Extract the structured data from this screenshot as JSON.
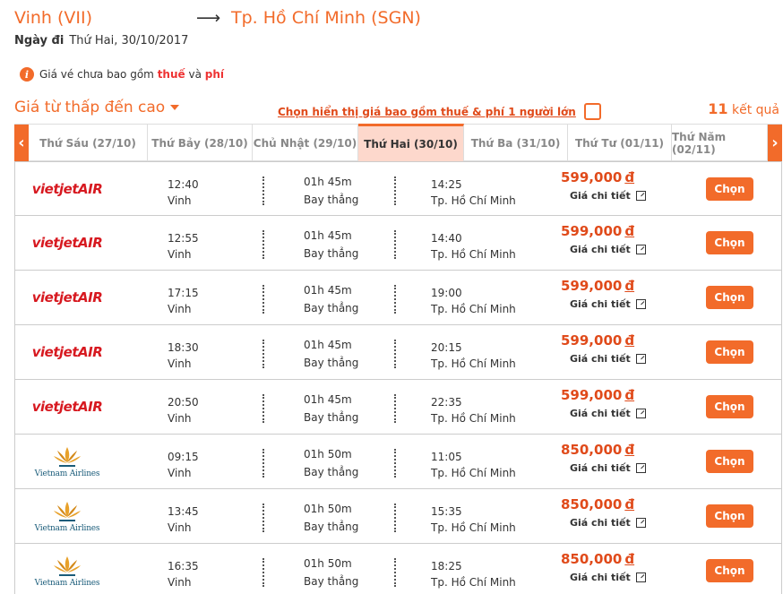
{
  "route": {
    "from": "Vinh (VII)",
    "arrow": "⟶",
    "to": "Tp. Hồ Chí Minh (SGN)"
  },
  "date": {
    "label": "Ngày đi",
    "value": "Thứ Hai, 30/10/2017"
  },
  "notice": {
    "prefix": "Giá vé chưa bao gồm",
    "tax": "thuế",
    "and": "và",
    "fee": "phí"
  },
  "sort": {
    "label": "Giá từ thấp đến cao"
  },
  "include_toggle": {
    "label": "Chọn hiển thị giá bao gồm thuế & phí 1 người lớn"
  },
  "results": {
    "count": "11",
    "label": "kết quả"
  },
  "date_tabs": [
    {
      "label": "Thứ Sáu (27/10)"
    },
    {
      "label": "Thứ Bảy (28/10)"
    },
    {
      "label": "Chủ Nhật (29/10)"
    },
    {
      "label": "Thứ Hai (30/10)",
      "active": true
    },
    {
      "label": "Thứ Ba (31/10)"
    },
    {
      "label": "Thứ Tư (01/11)"
    },
    {
      "label": "Thứ Năm (02/11)"
    }
  ],
  "nav": {
    "prev_icon": "chevron-left-icon",
    "next_icon": "chevron-right-icon"
  },
  "labels": {
    "detail": "Giá chi tiết",
    "choose": "Chọn",
    "currency": "đ"
  },
  "airlines": {
    "vietjet": {
      "brand_color": "#d71920",
      "logo_text": "VietJet Air"
    },
    "vietnam": {
      "brand_color": "#1a5c7a",
      "logo_text": "Vietnam Airlines"
    }
  },
  "flights": [
    {
      "airline": "vietjet",
      "dep_time": "12:40",
      "dep_city": "Vinh",
      "duration": "01h 45m",
      "type": "Bay thẳng",
      "arr_time": "14:25",
      "arr_city": "Tp. Hồ Chí Minh",
      "price": "599,000"
    },
    {
      "airline": "vietjet",
      "dep_time": "12:55",
      "dep_city": "Vinh",
      "duration": "01h 45m",
      "type": "Bay thẳng",
      "arr_time": "14:40",
      "arr_city": "Tp. Hồ Chí Minh",
      "price": "599,000"
    },
    {
      "airline": "vietjet",
      "dep_time": "17:15",
      "dep_city": "Vinh",
      "duration": "01h 45m",
      "type": "Bay thẳng",
      "arr_time": "19:00",
      "arr_city": "Tp. Hồ Chí Minh",
      "price": "599,000"
    },
    {
      "airline": "vietjet",
      "dep_time": "18:30",
      "dep_city": "Vinh",
      "duration": "01h 45m",
      "type": "Bay thẳng",
      "arr_time": "20:15",
      "arr_city": "Tp. Hồ Chí Minh",
      "price": "599,000"
    },
    {
      "airline": "vietjet",
      "dep_time": "20:50",
      "dep_city": "Vinh",
      "duration": "01h 45m",
      "type": "Bay thẳng",
      "arr_time": "22:35",
      "arr_city": "Tp. Hồ Chí Minh",
      "price": "599,000"
    },
    {
      "airline": "vietnam",
      "dep_time": "09:15",
      "dep_city": "Vinh",
      "duration": "01h 50m",
      "type": "Bay thẳng",
      "arr_time": "11:05",
      "arr_city": "Tp. Hồ Chí Minh",
      "price": "850,000"
    },
    {
      "airline": "vietnam",
      "dep_time": "13:45",
      "dep_city": "Vinh",
      "duration": "01h 50m",
      "type": "Bay thẳng",
      "arr_time": "15:35",
      "arr_city": "Tp. Hồ Chí Minh",
      "price": "850,000"
    },
    {
      "airline": "vietnam",
      "dep_time": "16:35",
      "dep_city": "Vinh",
      "duration": "01h 50m",
      "type": "Bay thẳng",
      "arr_time": "18:25",
      "arr_city": "Tp. Hồ Chí Minh",
      "price": "850,000"
    }
  ]
}
